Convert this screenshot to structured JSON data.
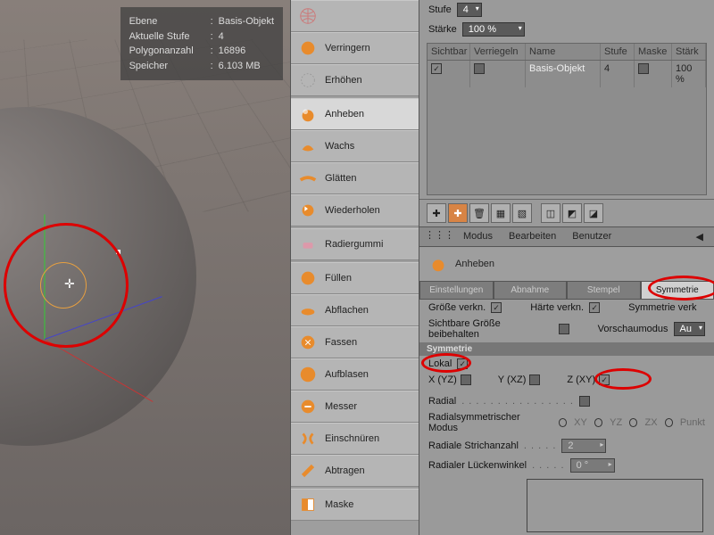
{
  "viewport": {
    "info": {
      "layer_k": "Ebene",
      "layer_v": "Basis-Objekt",
      "level_k": "Aktuelle Stufe",
      "level_v": "4",
      "poly_k": "Polygonanzahl",
      "poly_v": "16896",
      "mem_k": "Speicher",
      "mem_v": "6.103 MB"
    }
  },
  "tools": {
    "verringern": "Verringern",
    "erhoehen": "Erhöhen",
    "anheben": "Anheben",
    "wachs": "Wachs",
    "glaetten": "Glätten",
    "wiederholen": "Wiederholen",
    "radiergummi": "Radiergummi",
    "fuellen": "Füllen",
    "abflachen": "Abflachen",
    "fassen": "Fassen",
    "aufblasen": "Aufblasen",
    "messer": "Messer",
    "einschnueren": "Einschnüren",
    "abtragen": "Abtragen",
    "maske": "Maske"
  },
  "top": {
    "stufe_l": "Stufe",
    "stufe_v": "4",
    "staerke_l": "Stärke",
    "staerke_v": "100 %"
  },
  "layers": {
    "cols": {
      "visible": "Sichtbar",
      "lock": "Verriegeln",
      "name": "Name",
      "stufe": "Stufe",
      "maske": "Maske",
      "staerke": "Stärk"
    },
    "row": {
      "name": "Basis-Objekt",
      "stufe": "4",
      "staerke": "100 %"
    }
  },
  "menu": {
    "modus": "Modus",
    "bearbeiten": "Bearbeiten",
    "benutzer": "Benutzer"
  },
  "brush": {
    "title": "Anheben",
    "tabs": {
      "einst": "Einstellungen",
      "abnahme": "Abnahme",
      "stempel": "Stempel",
      "symmetrie": "Symmetrie"
    },
    "groesse": "Größe verkn.",
    "haerte": "Härte verkn.",
    "symverk": "Symmetrie verk",
    "sichtbare": "Sichtbare Größe beibehalten",
    "vorschau": "Vorschaumodus",
    "aus": "Au"
  },
  "sym": {
    "head": "Symmetrie",
    "lokal": "Lokal",
    "x": "X (YZ)",
    "y": "Y (XZ)",
    "z": "Z (XY)",
    "radial": "Radial",
    "radmod": "Radialsymmetrischer Modus",
    "xy": "XY",
    "yz": "YZ",
    "zx": "ZX",
    "punkt": "Punkt",
    "strich": "Radiale Strichanzahl",
    "strich_v": "2",
    "luecke": "Radialer Lückenwinkel",
    "luecke_v": "0 °"
  }
}
